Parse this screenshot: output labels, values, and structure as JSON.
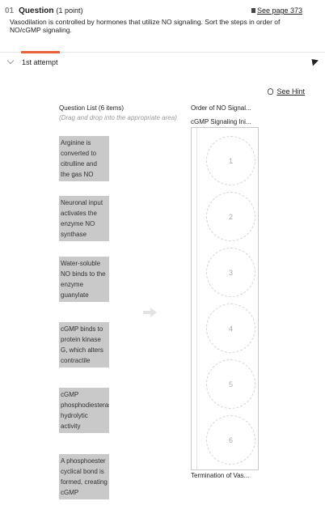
{
  "question": {
    "number": "01",
    "title": "Question",
    "points": "(1 point)",
    "see_page": "See page 373",
    "prompt": "Vasodilation is controlled by hormones that utilize NO signaling. Sort the steps in order of NO/cGMP signaling."
  },
  "attempt": {
    "label": "1st attempt"
  },
  "hint": {
    "label": "See Hint"
  },
  "question_list": {
    "header": "Question List (6 items)",
    "subtext": "(Drag and drop into the appropriate area)",
    "items": [
      "Arginine is converted to citrulline and the gas NO",
      "Neuronal input activates the enzyme NO synthase",
      "Water-soluble NO binds to the enzyme guanylate cyclase",
      "cGMP binds to protein kinase G, which alters contractile vascular cells",
      "cGMP phosphodiesterase hydrolytic activity terminates the",
      "A phosphoester cyclical bond is formed, creating cGMP"
    ]
  },
  "order_area": {
    "header": "Order of NO Signal...",
    "start_label": "cGMP Signaling Ini...",
    "end_label": "Termination of Vas...",
    "slots": [
      "1",
      "2",
      "3",
      "4",
      "5",
      "6"
    ]
  },
  "icons": {
    "book": "book-icon",
    "hint": "lightbulb-icon",
    "chevron": "chevron-down-icon",
    "collapse": "collapse-arrow-icon",
    "drag": "arrow-right-icon"
  },
  "colors": {
    "accent": "#e8613a",
    "card": "#c9c9c9"
  }
}
